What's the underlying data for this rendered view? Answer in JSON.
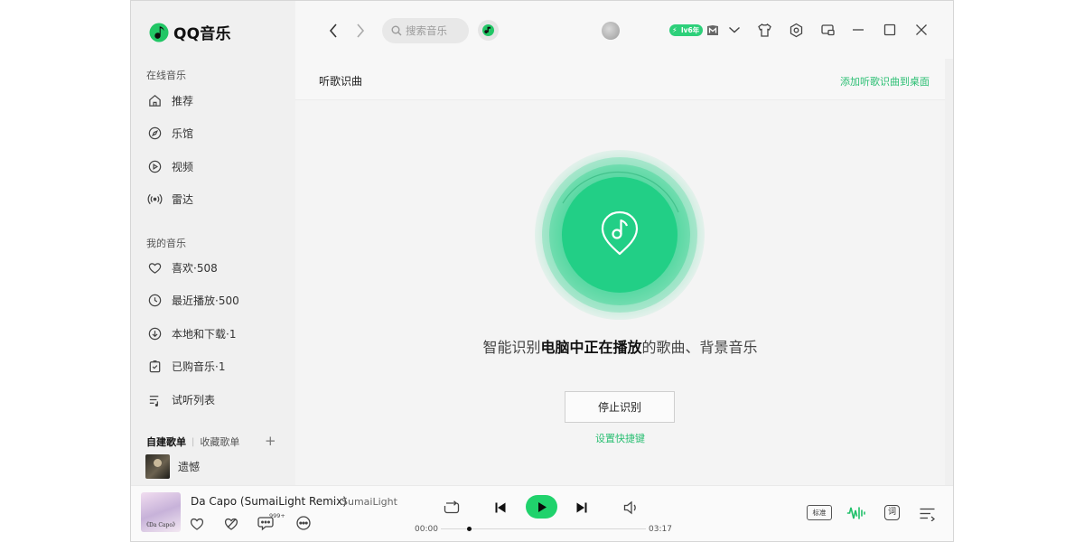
{
  "app": {
    "name": "QQ音乐"
  },
  "sidebar": {
    "online_title": "在线音乐",
    "online_items": [
      {
        "label": "推荐"
      },
      {
        "label": "乐馆"
      },
      {
        "label": "视频"
      },
      {
        "label": "雷达"
      }
    ],
    "my_title": "我的音乐",
    "my_items": [
      {
        "label": "喜欢·508"
      },
      {
        "label": "最近播放·500"
      },
      {
        "label": "本地和下载·1"
      },
      {
        "label": "已购音乐·1"
      },
      {
        "label": "试听列表"
      }
    ],
    "playlist_tabs": {
      "created": "自建歌单",
      "collected": "收藏歌单",
      "add": "+"
    },
    "playlists": [
      {
        "label": "遗憾"
      }
    ]
  },
  "topbar": {
    "search_placeholder": "搜索音乐",
    "vip_badge": "lv6年"
  },
  "content": {
    "page_title": "听歌识曲",
    "add_desktop": "添加听歌识曲到桌面",
    "desc_prefix": "智能识别",
    "desc_highlight": "电脑中正在播放",
    "desc_suffix": "的歌曲、背景音乐",
    "stop_button": "停止识别",
    "shortcut_link": "设置快捷键"
  },
  "player": {
    "song_title": "Da Capo (SumaiLight Remix)",
    "separator": "-",
    "artist": "SumaiLight",
    "album_art_text": "《Da Capo》",
    "comment_count": "999+",
    "time_current": "00:00",
    "time_total": "03:17",
    "progress": 0.0,
    "quality": "标准",
    "lyric": "词"
  },
  "colors": {
    "accent": "#20d26c",
    "link_green": "#2bbf73",
    "disc_green": "#22cf86"
  }
}
